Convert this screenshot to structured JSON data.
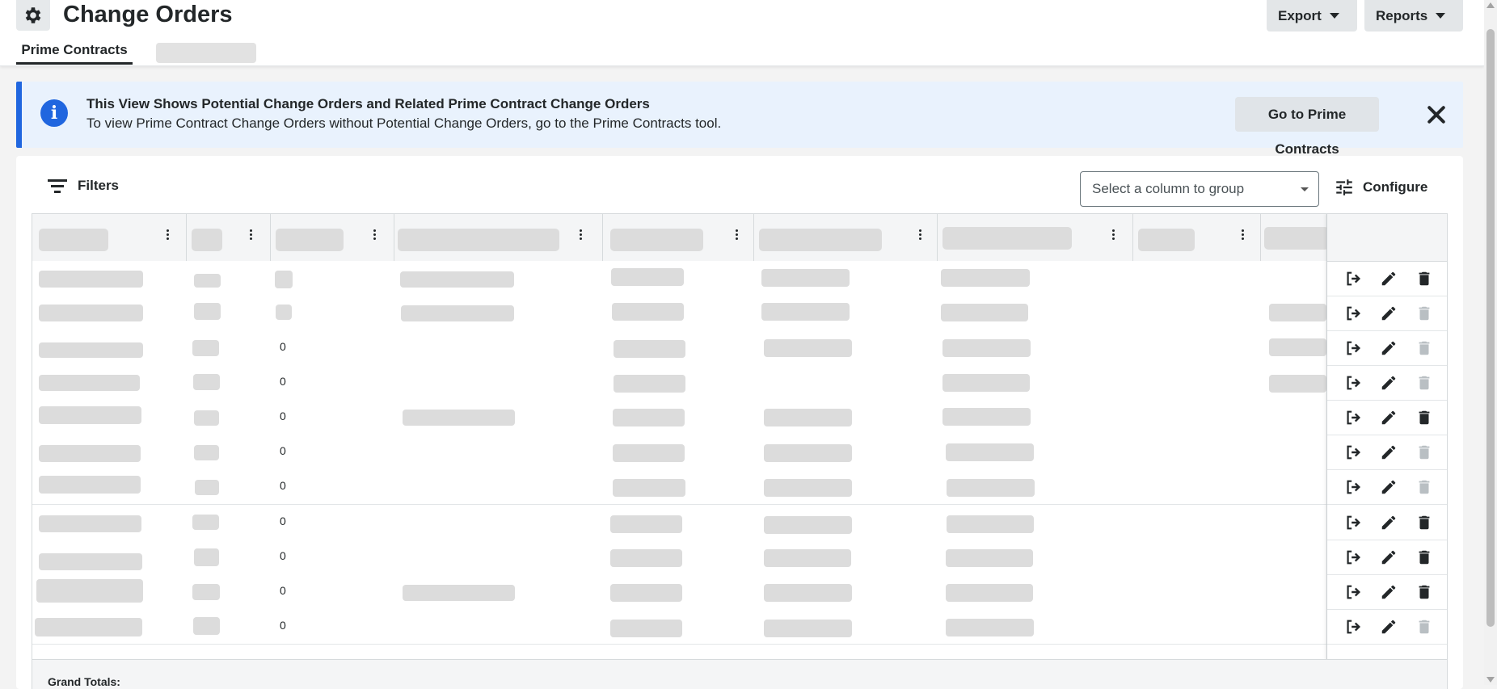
{
  "header": {
    "title": "Change Orders",
    "icon": "gear-icon",
    "export_label": "Export",
    "reports_label": "Reports"
  },
  "tabs": [
    {
      "label": "Prime Contracts",
      "active": true
    }
  ],
  "banner": {
    "title": "This View Shows Potential Change Orders and Related Prime Contract Change Orders",
    "body": "To view Prime Contract Change Orders without Potential Change Orders, go to the Prime Contracts tool.",
    "button_label": "Go to Prime Contracts",
    "icon": "info-icon",
    "accent": "#2066df"
  },
  "toolbar": {
    "filters_label": "Filters",
    "group_placeholder": "Select a column to group",
    "configure_label": "Configure"
  },
  "table": {
    "row_values": [
      "",
      "",
      "0",
      "0",
      "0",
      "0",
      "0",
      "0",
      "0",
      "0",
      "0"
    ],
    "delete_enabled": [
      true,
      false,
      false,
      false,
      true,
      false,
      false,
      true,
      true,
      true,
      false
    ],
    "grand_totals_label": "Grand Totals:"
  }
}
